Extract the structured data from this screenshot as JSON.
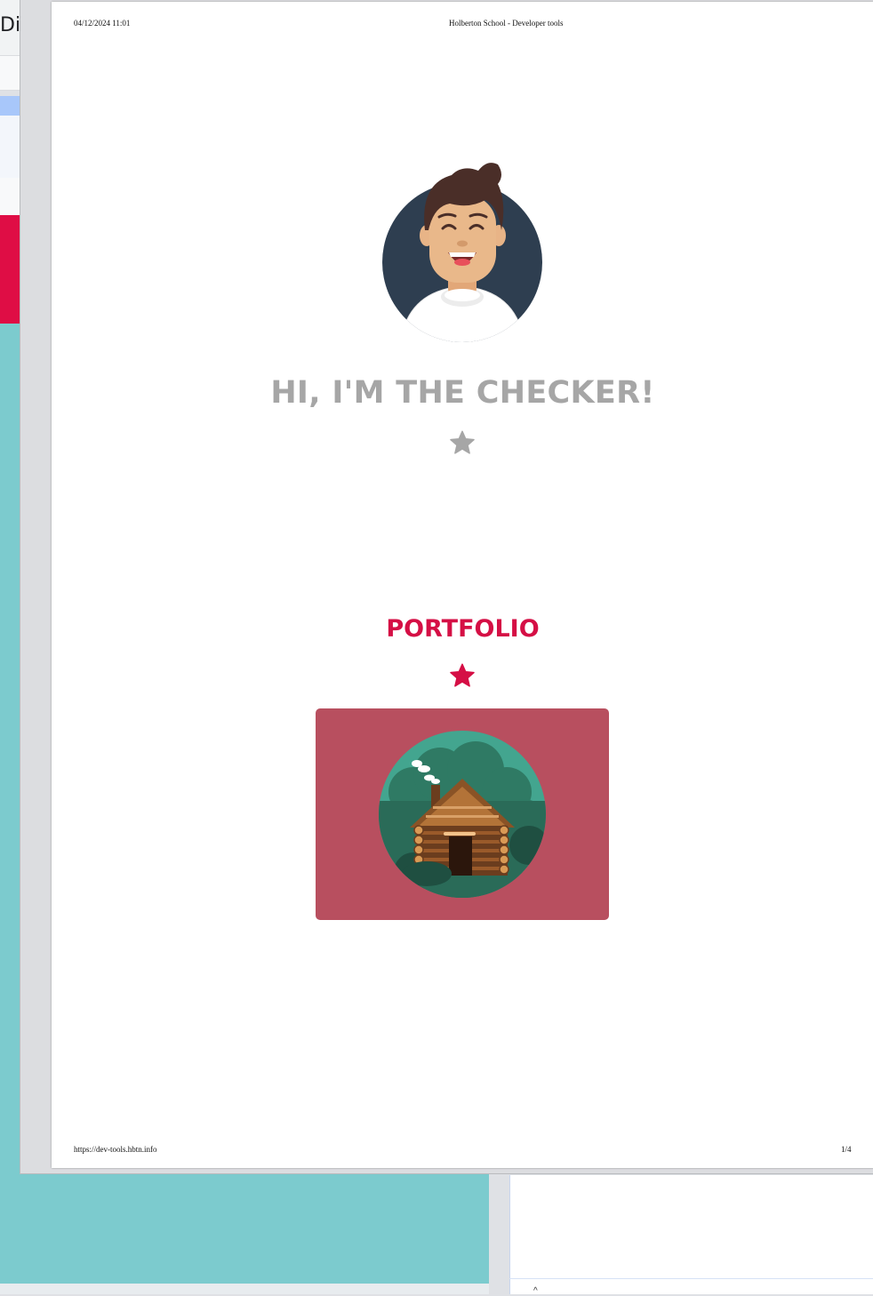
{
  "background_window": {
    "title_fragment": "Di"
  },
  "print_preview": {
    "header": {
      "date": "04/12/2024 11:01",
      "title": "Holberton School - Developer tools"
    },
    "footer": {
      "url": "https://dev-tools.hbtn.info",
      "page": "1/4"
    },
    "content": {
      "hero_title": "HI, I'M THE CHECKER!",
      "portfolio_title": "PORTFOLIO"
    },
    "icons": {
      "avatar": "avatar-illustration",
      "hero_divider": "star-icon",
      "portfolio_divider": "star-icon",
      "portfolio_thumbnail": "log-cabin-illustration"
    },
    "colors": {
      "hero_title": "#a6a6a6",
      "accent_red": "#d50f45",
      "card_background": "#b84f5f",
      "teal_background": "#7ccbce"
    }
  }
}
